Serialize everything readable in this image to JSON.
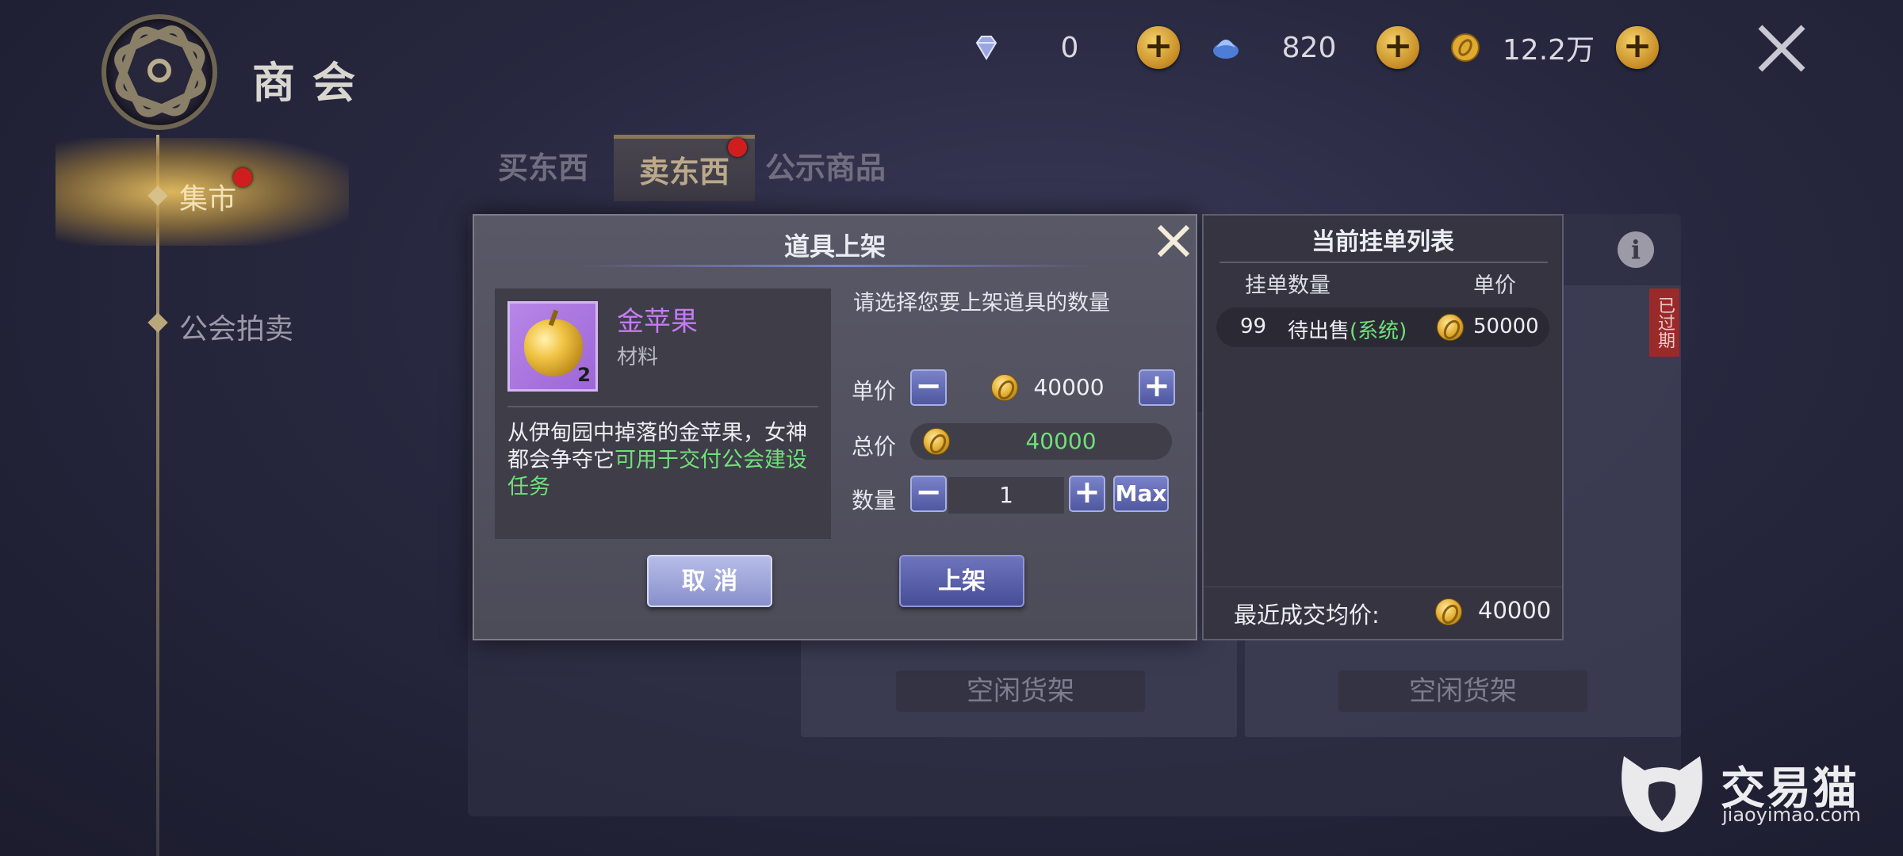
{
  "header": {
    "title": "商会",
    "currencies": [
      {
        "icon": "diamond-icon",
        "value": "0"
      },
      {
        "icon": "crystal-icon",
        "value": "820"
      },
      {
        "icon": "gold-coin-icon",
        "value": "12.2万"
      }
    ]
  },
  "sidebar": {
    "items": [
      {
        "label": "集市",
        "active": true,
        "badge": true
      },
      {
        "label": "公会拍卖",
        "active": false,
        "badge": false
      }
    ]
  },
  "tabs": [
    {
      "label": "买东西",
      "active": false
    },
    {
      "label": "卖东西",
      "active": true,
      "badge": true
    },
    {
      "label": "公示商品",
      "active": false
    }
  ],
  "shelves": {
    "empty_label": "空闲货架",
    "expired_tag": "已过期"
  },
  "dialog": {
    "title": "道具上架",
    "item": {
      "name": "金苹果",
      "type": "材料",
      "count": "2",
      "desc_plain": "从伊甸园中掉落的金苹果，女神都会争夺它",
      "desc_highlight": "可用于交付公会建设任务"
    },
    "prompt": "请选择您要上架道具的数量",
    "unit_price_label": "单价",
    "unit_price": "40000",
    "total_label": "总价",
    "total": "40000",
    "qty_label": "数量",
    "qty": "1",
    "max_label": "Max",
    "cancel_label": "取 消",
    "confirm_label": "上架"
  },
  "orders": {
    "title": "当前挂单列表",
    "col_qty": "挂单数量",
    "col_price": "单价",
    "rows": [
      {
        "qty": "99",
        "status": "待出售",
        "source": "(系统)",
        "price": "50000"
      }
    ],
    "recent_label": "最近成交均价:",
    "recent_price": "40000"
  },
  "watermark": {
    "name": "交易猫",
    "url": "jiaoyimao.com"
  },
  "colors": {
    "accent_gold": "#d8c08a",
    "item_name_purple": "#c47af0",
    "highlight_green": "#6fe07a",
    "button_blue": "#5b63b0"
  }
}
